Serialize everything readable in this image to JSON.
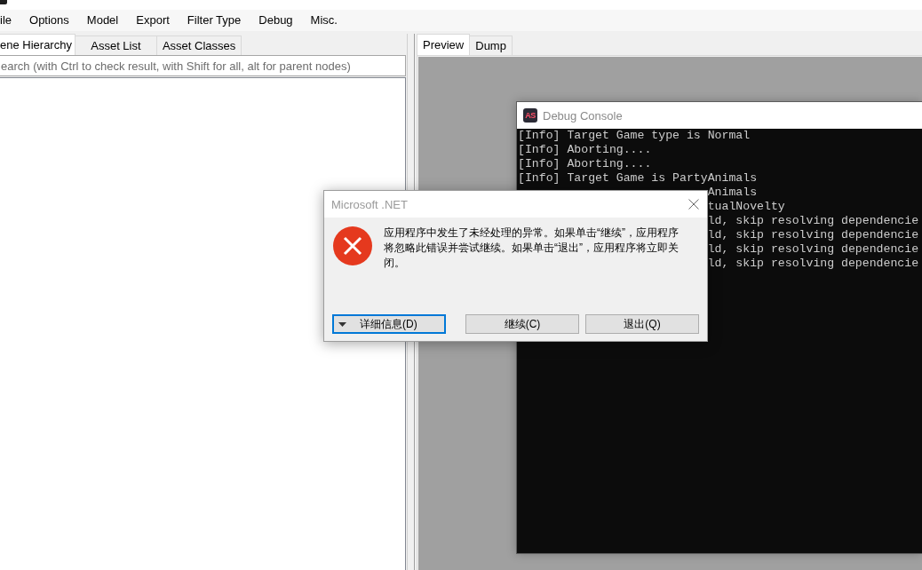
{
  "menu_bar": {
    "items": [
      "ile",
      "Options",
      "Model",
      "Export",
      "Filter Type",
      "Debug",
      "Misc."
    ]
  },
  "left_pane": {
    "tabs": [
      {
        "label": "ene Hierarchy",
        "selected": true
      },
      {
        "label": "Asset List",
        "selected": false
      },
      {
        "label": "Asset Classes",
        "selected": false
      }
    ],
    "search": {
      "placeholder": "earch (with Ctrl to check result, with Shift for all, alt for parent nodes)"
    }
  },
  "right_pane": {
    "tabs": [
      {
        "label": "Preview",
        "selected": true
      },
      {
        "label": "Dump",
        "selected": false
      }
    ]
  },
  "debug_console": {
    "logo_text": "AS",
    "title": "Debug Console",
    "lines": [
      {
        "kind": "full",
        "text": "[Info] Target Game type is Normal"
      },
      {
        "kind": "full",
        "text": "[Info] Aborting...."
      },
      {
        "kind": "full",
        "text": "[Info] Aborting...."
      },
      {
        "kind": "full",
        "text": "[Info] Target Game is PartyAnimals"
      },
      {
        "kind": "partial",
        "text": "Animals"
      },
      {
        "kind": "partial",
        "text": "tualNovelty"
      },
      {
        "kind": "partial",
        "text": "ld, skip resolving dependencie"
      },
      {
        "kind": "partial",
        "text": "ld, skip resolving dependencie"
      },
      {
        "kind": "partial",
        "text": "ld, skip resolving dependencie"
      },
      {
        "kind": "partial",
        "text": "ld, skip resolving dependencie"
      }
    ]
  },
  "error_dialog": {
    "title": "Microsoft .NET",
    "message": "应用程序中发生了未经处理的异常。如果单击“继续”，应用程序将忽略此错误并尝试继续。如果单击“退出”，应用程序将立即关闭。",
    "buttons": [
      {
        "kind": "expander",
        "label": "详细信息(D)",
        "focused": true
      },
      {
        "kind": "plain",
        "label": "继续(C)",
        "focused": false
      },
      {
        "kind": "plain",
        "label": "退出(Q)",
        "focused": false
      }
    ]
  }
}
